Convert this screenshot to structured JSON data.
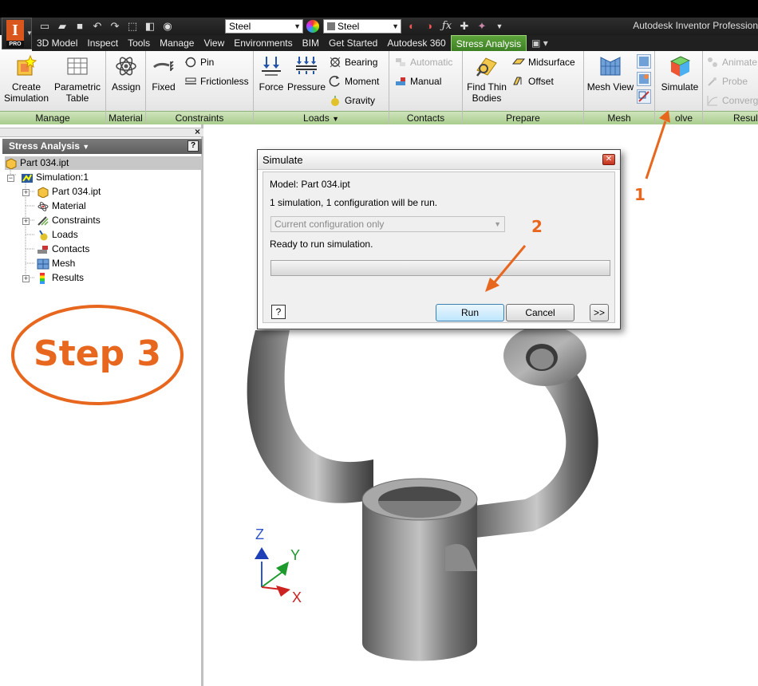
{
  "app": {
    "title": "Autodesk Inventor Profession",
    "pro_badge": "PRO",
    "logo_letter": "I"
  },
  "quick_access": {
    "material_combo": "Steel",
    "appearance_combo": "Steel"
  },
  "tabs": [
    {
      "label": "3D Model",
      "active": false
    },
    {
      "label": "Inspect",
      "active": false
    },
    {
      "label": "Tools",
      "active": false
    },
    {
      "label": "Manage",
      "active": false
    },
    {
      "label": "View",
      "active": false
    },
    {
      "label": "Environments",
      "active": false
    },
    {
      "label": "BIM",
      "active": false
    },
    {
      "label": "Get Started",
      "active": false
    },
    {
      "label": "Autodesk 360",
      "active": false
    },
    {
      "label": "Stress Analysis",
      "active": true
    }
  ],
  "ribbon": {
    "manage": {
      "title": "Manage",
      "create_simulation": [
        "Create",
        "Simulation"
      ],
      "parametric_table": [
        "Parametric",
        "Table"
      ]
    },
    "material": {
      "title": "Material",
      "assign": "Assign"
    },
    "constraints": {
      "title": "Constraints",
      "fixed": "Fixed",
      "pin": "Pin",
      "frictionless": "Frictionless"
    },
    "loads": {
      "title": "Loads",
      "force": "Force",
      "pressure": "Pressure",
      "bearing": "Bearing",
      "moment": "Moment",
      "gravity": "Gravity"
    },
    "contacts": {
      "title": "Contacts",
      "automatic": "Automatic",
      "manual": "Manual"
    },
    "prepare": {
      "title": "Prepare",
      "find_thin_bodies": [
        "Find Thin",
        "Bodies"
      ],
      "midsurface": "Midsurface",
      "offset": "Offset"
    },
    "mesh": {
      "title": "Mesh",
      "mesh_view": "Mesh View"
    },
    "solve": {
      "title": "olve",
      "simulate": "Simulate"
    },
    "result": {
      "title": "Result",
      "animate": "Animate",
      "probe": "Probe",
      "converge": "Converg"
    }
  },
  "browser": {
    "header": "Stress Analysis",
    "root": "Part 034.ipt",
    "simulation": "Simulation:1",
    "items": [
      "Part 034.ipt",
      "Material",
      "Constraints",
      "Loads",
      "Contacts",
      "Mesh",
      "Results"
    ]
  },
  "step_label": "Step 3",
  "dialog": {
    "title": "Simulate",
    "model": "Model: Part 034.ipt",
    "info": "1 simulation, 1 configuration will be run.",
    "configuration": "Current configuration only",
    "status": "Ready to run simulation.",
    "progress": 0,
    "run": "Run",
    "cancel": "Cancel",
    "more": ">>",
    "help": "?"
  },
  "annotations": {
    "one": "1",
    "two": "2"
  },
  "axes": {
    "z": "Z",
    "y": "Y",
    "x": "X"
  },
  "colors": {
    "accent_orange": "#e8671e",
    "tab_green": "#4a9a2c",
    "panel_title_green": "#b5d59b"
  }
}
